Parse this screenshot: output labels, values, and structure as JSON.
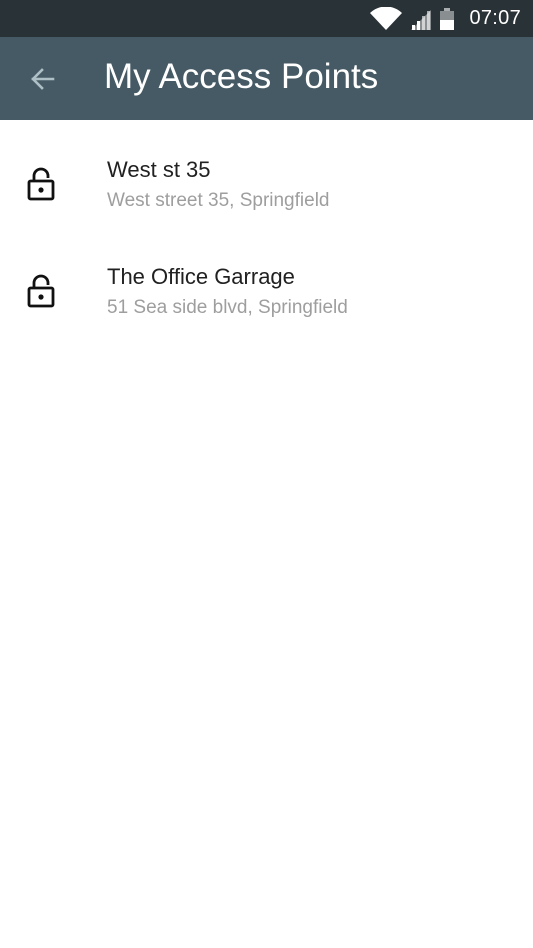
{
  "status_bar": {
    "time": "07:07",
    "icons": [
      "wifi-icon",
      "signal-icon",
      "battery-icon"
    ]
  },
  "app_bar": {
    "title": "My Access Points",
    "back_icon": "arrow-back-icon"
  },
  "access_points": [
    {
      "name": "West st 35",
      "address": "West street 35, Springfield",
      "icon": "lock-icon"
    },
    {
      "name": "The Office Garrage",
      "address": "51 Sea side blvd, Springfield",
      "icon": "lock-icon"
    }
  ],
  "colors": {
    "status_bar_bg": "#283237",
    "app_bar_bg": "#455a64",
    "title_text": "#212121",
    "subtitle_text": "#9e9e9e"
  }
}
